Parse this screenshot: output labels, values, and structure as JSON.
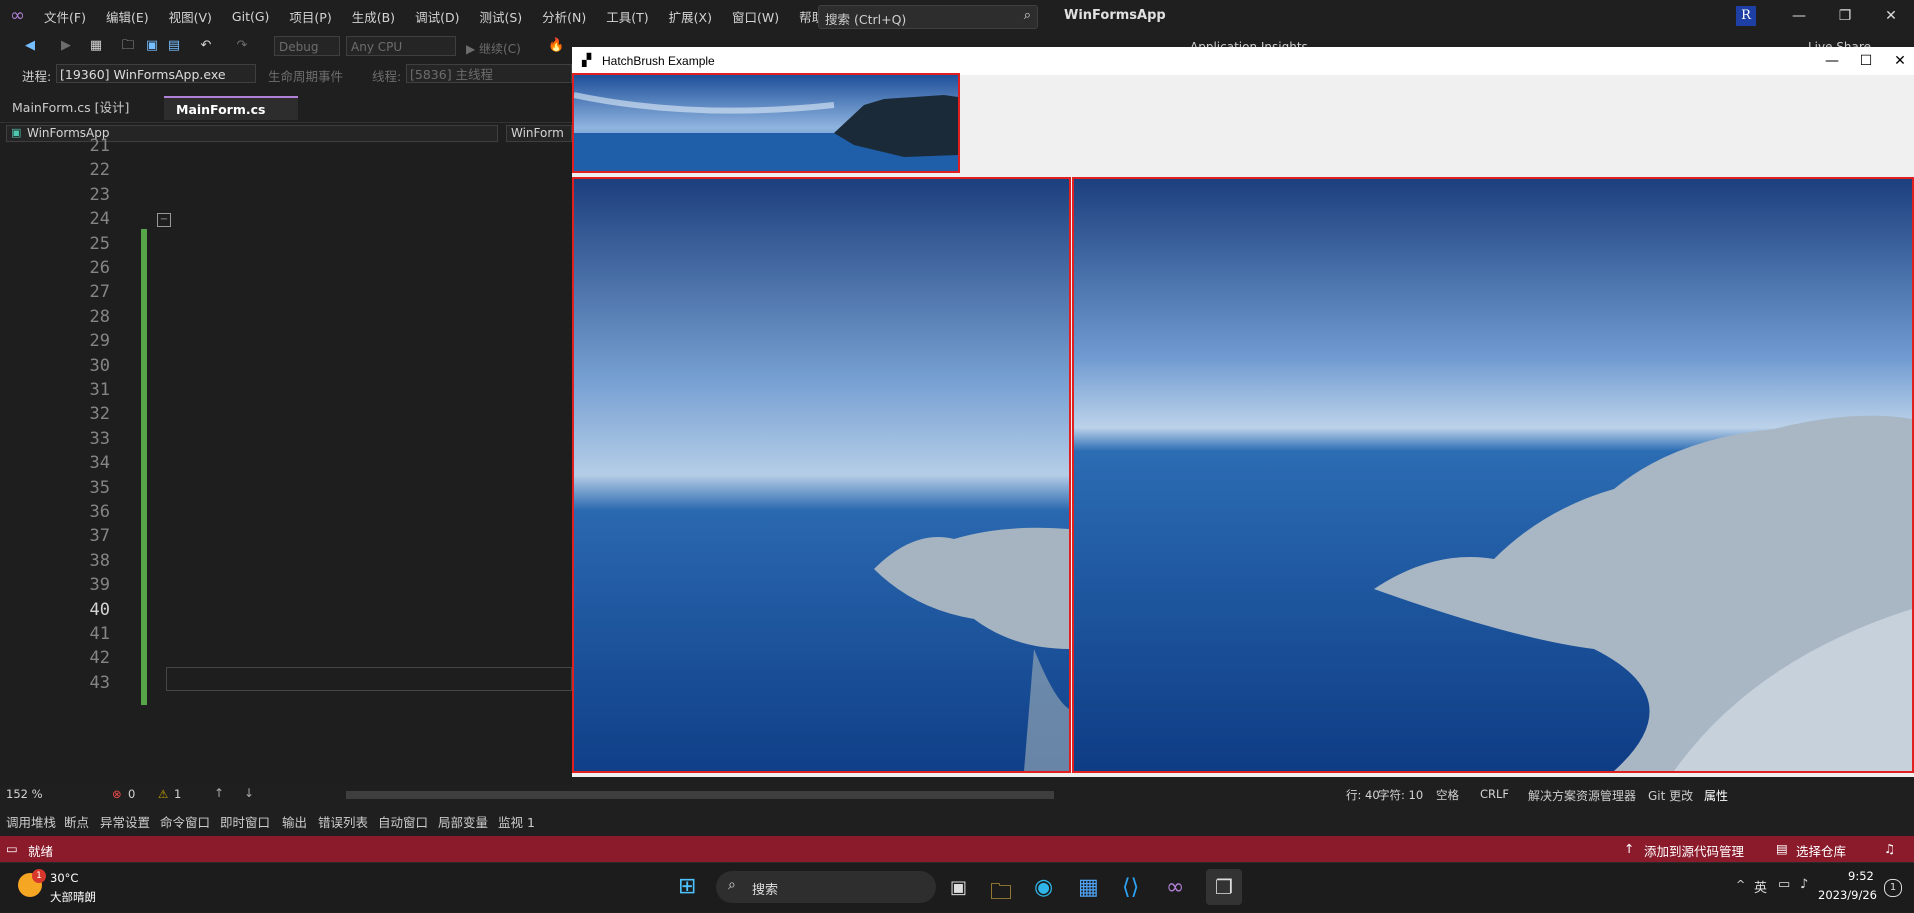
{
  "menubar": {
    "items": [
      "文件(F)",
      "编辑(E)",
      "视图(V)",
      "Git(G)",
      "项目(P)",
      "生成(B)",
      "调试(D)",
      "测试(S)",
      "分析(N)",
      "工具(T)",
      "扩展(X)",
      "窗口(W)",
      "帮助(H)"
    ],
    "search_placeholder": "搜索 (Ctrl+Q)",
    "app_title": "WinFormsApp",
    "avatar_letter": "R"
  },
  "toolbar": {
    "config": "Debug",
    "platform": "Any CPU",
    "continue_label": "继续(C)",
    "insights_label": "Application Insights",
    "liveshare_label": "Live Share"
  },
  "process_bar": {
    "process_label": "进程:",
    "process_value": "[19360] WinFormsApp.exe",
    "lifecycle_label": "生命周期事件",
    "thread_label": "线程:",
    "thread_value": "[5836] 主线程"
  },
  "tabs": [
    {
      "label": "MainForm.cs [设计]",
      "active": false
    },
    {
      "label": "MainForm.cs",
      "active": true
    }
  ],
  "nav": {
    "project": "WinFormsApp",
    "class": "WinForm"
  },
  "editor": {
    "line_numbers": [
      "21",
      "22",
      "23",
      "24",
      "25",
      "26",
      "27",
      "28",
      "29",
      "30",
      "31",
      "32",
      "33",
      "34",
      "35",
      "36",
      "37",
      "38",
      "39",
      "40",
      "41",
      "42",
      "43"
    ]
  },
  "editor_status": {
    "zoom": "152 %",
    "errors": "0",
    "warnings": "1",
    "line": "行: 40",
    "char": "字符: 10",
    "indent": "空格",
    "eol": "CRLF",
    "panel_tabs": [
      "解决方案资源管理器",
      "Git 更改",
      "属性"
    ]
  },
  "bottom_tabs": [
    "调用堆栈",
    "断点",
    "异常设置",
    "命令窗口",
    "即时窗口",
    "输出",
    "错误列表",
    "自动窗口",
    "局部变量",
    "监视 1"
  ],
  "statusbar": {
    "ready": "就绪",
    "add_source": "添加到源代码管理",
    "select_repo": "选择仓库"
  },
  "taskbar": {
    "temp": "30°C",
    "weather": "大部晴朗",
    "badge": "1",
    "search": "搜索",
    "ime": "英",
    "time": "9:52",
    "date": "2023/9/26",
    "notif": "1"
  },
  "winform": {
    "title": "HatchBrush Example"
  },
  "colors": {
    "status_bar": "#8b1a2b",
    "accent_purple": "#b180d7",
    "highlight_border": "#e02020"
  }
}
